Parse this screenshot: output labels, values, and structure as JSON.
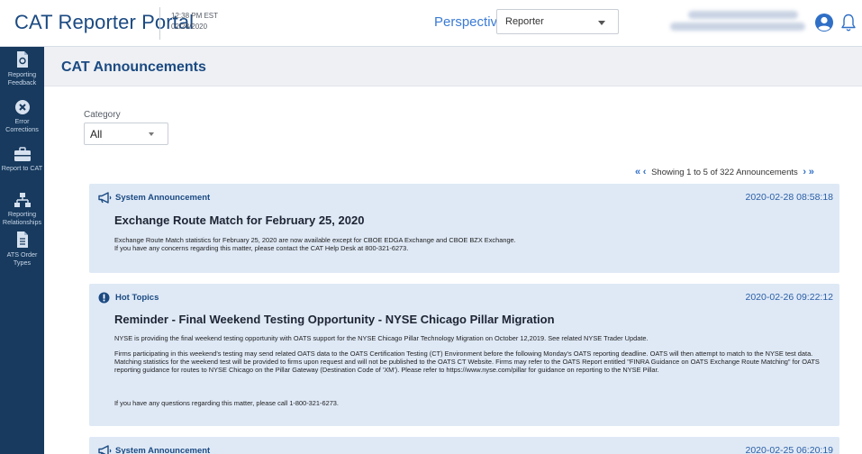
{
  "header": {
    "app_title": "CAT Reporter Portal",
    "time": "12:38 PM EST",
    "date": "02/28/2020",
    "perspective_label": "Perspective",
    "perspective_value": "Reporter"
  },
  "sidebar": {
    "items": [
      {
        "label": "Reporting Feedback",
        "icon": "document-icon"
      },
      {
        "label": "Error Corrections",
        "icon": "error-circle-icon"
      },
      {
        "label": "Report to CAT",
        "icon": "briefcase-icon"
      },
      {
        "label": "Reporting Relationships",
        "icon": "org-chart-icon"
      },
      {
        "label": "ATS Order Types",
        "icon": "file-list-icon"
      }
    ]
  },
  "page": {
    "title": "CAT Announcements",
    "category_label": "Category",
    "category_value": "All",
    "pagination_text": "Showing 1 to 5 of 322 Announcements"
  },
  "announcements": [
    {
      "category": "System Announcement",
      "icon": "megaphone-icon",
      "date": "2020-02-28   08:58:18",
      "title": "Exchange Route Match for February 25, 2020",
      "paragraphs": [
        "Exchange Route Match statistics for February 25, 2020 are now available except for CBOE EDGA Exchange and CBOE BZX Exchange.\nIf you have any concerns regarding this matter, please contact the CAT Help Desk at 800-321-6273."
      ]
    },
    {
      "category": "Hot Topics",
      "icon": "alert-icon",
      "date": "2020-02-26  09:22:12",
      "title": "Reminder - Final Weekend Testing Opportunity - NYSE Chicago Pillar Migration",
      "paragraphs": [
        "NYSE is providing the final weekend testing opportunity with OATS support for the NYSE Chicago Pillar Technology Migration on October 12,2019. See related NYSE Trader Update.",
        "Firms participating in this weekend's testing may send related OATS data to the OATS Certification Testing (CT) Environment before the following Monday's OATS reporting deadline. OATS will then attempt to match to the NYSE test data. Matching statistics for the weekend test will be provided to firms upon request and will not be published to the OATS CT Website. Firms may refer to the OATS Report entitled \"FINRA Guidance on OATS Exchange Route Matching\" for OATS reporting guidance for routes to NYSE Chicago on the Pillar Gateway (Destination Code of 'XM'). Please refer to https://www.nyse.com/pillar for guidance on reporting to the NYSE Pillar.",
        "If you have any questions regarding this matter, please call 1-800-321-6273."
      ]
    },
    {
      "category": "System Announcement",
      "icon": "megaphone-icon",
      "date": "2020-02-25  06:20:19",
      "title": "",
      "paragraphs": []
    }
  ],
  "colors": {
    "brand_blue": "#1b4a82",
    "sidebar_bg": "#173a5e",
    "card_bg": "#dfe9f6",
    "link_blue": "#2f6fc6"
  }
}
